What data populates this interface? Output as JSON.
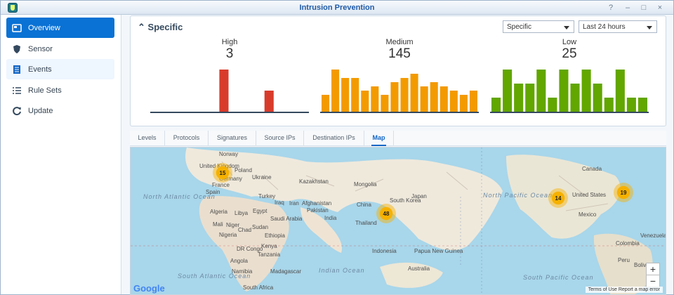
{
  "window": {
    "title": "Intrusion Prevention",
    "controls": [
      "?",
      "–",
      "□",
      "×"
    ]
  },
  "sidebar": {
    "items": [
      {
        "label": "Overview",
        "icon": "overview-icon",
        "active": true
      },
      {
        "label": "Sensor",
        "icon": "shield-icon",
        "active": false
      },
      {
        "label": "Events",
        "icon": "events-icon",
        "active": false
      },
      {
        "label": "Rule Sets",
        "icon": "list-icon",
        "active": false
      },
      {
        "label": "Update",
        "icon": "refresh-icon",
        "active": false
      }
    ]
  },
  "panel": {
    "title": "Specific",
    "filter_value": "Specific",
    "time_range": "Last 24 hours"
  },
  "metrics": [
    {
      "label": "High",
      "value": "3",
      "color": "#d93b2b"
    },
    {
      "label": "Medium",
      "value": "145",
      "color": "#f39a00"
    },
    {
      "label": "Low",
      "value": "25",
      "color": "#62a600"
    }
  ],
  "tabs": [
    "Levels",
    "Protocols",
    "Signatures",
    "Source IPs",
    "Destination IPs",
    "Map"
  ],
  "chart_data": [
    {
      "type": "bar",
      "title": "High",
      "values": [
        0,
        0,
        0,
        0,
        0,
        0,
        2,
        0,
        0,
        0,
        1,
        0,
        0,
        0
      ],
      "ylim": [
        0,
        2
      ]
    },
    {
      "type": "bar",
      "title": "Medium",
      "values": [
        4,
        10,
        8,
        8,
        5,
        6,
        4,
        7,
        8,
        9,
        6,
        7,
        6,
        5,
        4,
        5
      ],
      "ylim": [
        0,
        10
      ]
    },
    {
      "type": "bar",
      "title": "Low",
      "values": [
        1,
        3,
        2,
        2,
        3,
        1,
        3,
        2,
        3,
        2,
        1,
        3,
        1,
        1
      ],
      "ylim": [
        0,
        3
      ]
    }
  ],
  "map": {
    "countries": [
      "Norway",
      "United Kingdom",
      "Poland",
      "Ukraine",
      "Germany",
      "France",
      "Spain",
      "Turkey",
      "Iraq",
      "Iran",
      "Afghanistan",
      "Pakistan",
      "India",
      "Kazakhstan",
      "Mongolia",
      "China",
      "Japan",
      "South Korea",
      "Algeria",
      "Libya",
      "Egypt",
      "Saudi Arabia",
      "Mali",
      "Niger",
      "Chad",
      "Sudan",
      "Ethiopia",
      "Nigeria",
      "DR Congo",
      "Kenya",
      "Tanzania",
      "Angola",
      "Namibia",
      "Madagascar",
      "South Africa",
      "Thailand",
      "Indonesia",
      "Papua New Guinea",
      "Australia",
      "Canada",
      "United States",
      "Mexico",
      "Venezuela",
      "Colombia",
      "Peru",
      "Bolivia"
    ],
    "oceans": [
      "North Atlantic Ocean",
      "North Pacific Ocean",
      "South Atlantic Ocean",
      "Indian Ocean",
      "South Pacific Ocean"
    ],
    "clusters": [
      "15",
      "48",
      "14",
      "19"
    ],
    "zoom_in": "+",
    "zoom_out": "−",
    "footer": "Terms of Use   Report a map error",
    "provider": "Google"
  }
}
